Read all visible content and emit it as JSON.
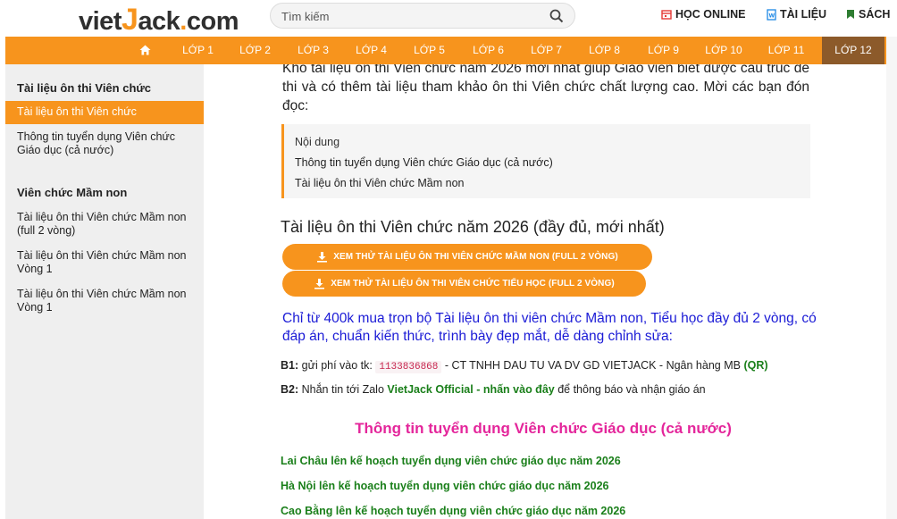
{
  "header": {
    "logo_prefix": "viet",
    "logo_j": "J",
    "logo_suffix": "ack",
    "logo_dot": ".",
    "logo_tld": "com",
    "search_placeholder": "Tìm kiếm",
    "links": [
      {
        "label": "HỌC ONLINE",
        "icon": "calendar-icon",
        "color": "#e53935"
      },
      {
        "label": "TÀI LIỆU",
        "icon": "document-icon",
        "color": "#1e88e5"
      },
      {
        "label": "SÁCH",
        "icon": "bookmark-icon",
        "color": "#2e7d32"
      }
    ]
  },
  "nav": {
    "home_icon": "home-icon",
    "items": [
      "LỚP 1",
      "LỚP 2",
      "LỚP 3",
      "LỚP 4",
      "LỚP 5",
      "LỚP 6",
      "LỚP 7",
      "LỚP 8",
      "LỚP 9",
      "LỚP 10",
      "LỚP 11",
      "LỚP 12"
    ],
    "active_index": 11,
    "accent_color": "#f7941d",
    "active_color": "#8c5a2a"
  },
  "sidebar": {
    "sections": [
      {
        "heading": "Tài liệu ôn thi Viên chức",
        "items": [
          "Tài liệu ôn thi Viên chức",
          "Thông tin tuyển dụng Viên chức Giáo dục (cả nước)"
        ]
      },
      {
        "heading": "Viên chức Mầm non",
        "items": [
          "Tài liệu ôn thi Viên chức Mầm non (full 2 vòng)",
          "Tài liệu ôn thi Viên chức Mầm non Vòng 1",
          "Tài liệu ôn thi Viên chức Mầm non Vòng 1"
        ]
      }
    ],
    "active_item": "Tài liệu ôn thi Viên chức"
  },
  "main": {
    "intro": "Kho tài liệu ôn thi Viên chức năm 2026 mới nhất giúp Giáo viên biết được cấu trúc đề thi và có thêm tài liệu tham khảo ôn thi Viên chức chất lượng cao. Mời các bạn đón đọc:",
    "toc": {
      "title": "Nội dung",
      "links": [
        "Thông tin tuyển dụng Viên chức Giáo dục (cả nước)",
        "Tài liệu ôn thi Viên chức Mầm non"
      ]
    },
    "section_title": "Tài liệu ôn thi Viên chức năm 2026 (đầy đủ, mới nhất)",
    "buttons": [
      "XEM THỬ TÀI LIỆU ÔN THI VIÊN CHỨC MẦM NON (FULL 2 VÒNG)",
      "XEM THỬ TÀI LIỆU ÔN THI VIÊN CHỨC TIỂU HỌC (FULL 2 VÒNG)"
    ],
    "promo": "Chỉ từ 400k mua trọn bộ Tài liệu ôn thi viên chức Mầm non, Tiểu học đầy đủ 2 vòng, có đáp án, chuẩn kiến thức, trình bày đẹp mắt, dễ dàng chỉnh sửa:",
    "step1": {
      "label": "B1:",
      "text_before": " gửi phí vào tk: ",
      "account": "1133836868",
      "text_after": " - CT TNHH DAU TU VA DV GD VIETJACK - Ngân hàng MB ",
      "qr": "(QR)"
    },
    "step2": {
      "label": "B2:",
      "text_before": " Nhắn tin tới Zalo ",
      "zalo": "VietJack Official - nhấn vào đây",
      "text_after": " để thông báo và nhận giáo án"
    },
    "recruit_heading": "Thông tin tuyển dụng Viên chức Giáo dục (cả nước)",
    "recruit_links": [
      "Lai Châu lên kế hoạch tuyển dụng viên chức giáo dục năm 2026",
      "Hà Nội lên kế hoạch tuyển dụng viên chức giáo dục năm 2026",
      "Cao Bằng lên kế hoạch tuyển dụng viên chức giáo dục năm 2026"
    ]
  }
}
